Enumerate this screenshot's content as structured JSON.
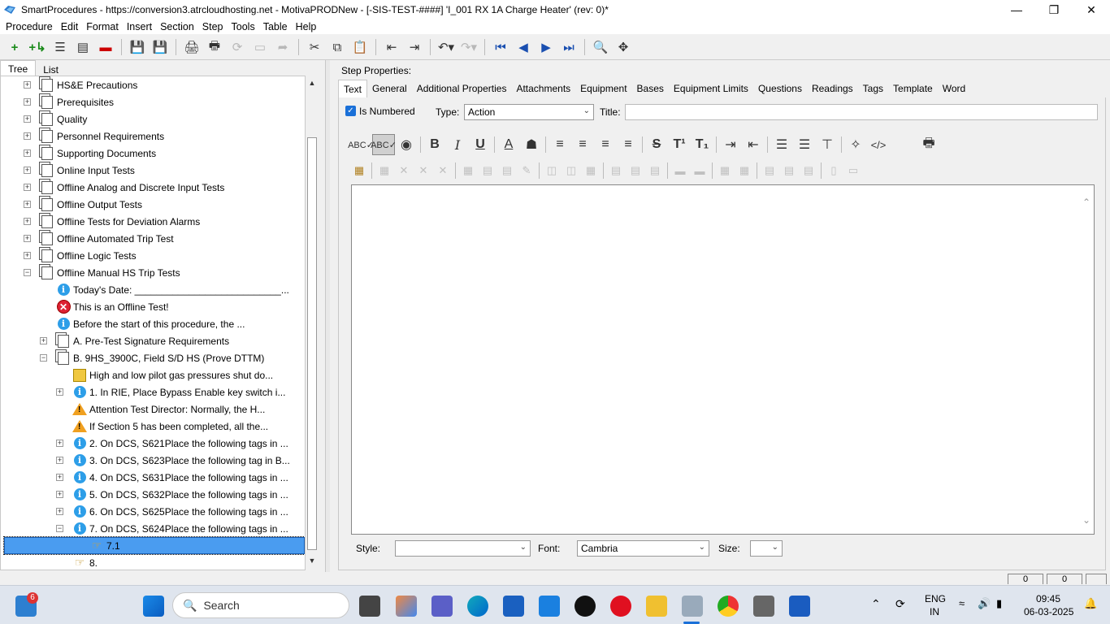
{
  "window": {
    "title": "SmartProcedures - https://conversion3.atrcloudhosting.net - MotivaPRODNew - [-SIS-TEST-####] 'I_001 RX 1A Charge Heater' (rev: 0)*"
  },
  "menu": [
    "Procedure",
    "Edit",
    "Format",
    "Insert",
    "Section",
    "Step",
    "Tools",
    "Table",
    "Help"
  ],
  "left_tabs": {
    "tree": "Tree",
    "list": "List"
  },
  "tree": [
    {
      "label": "HS&E Precautions",
      "icon": "document-icon",
      "expander": "+",
      "level": 0
    },
    {
      "label": "Prerequisites",
      "icon": "document-icon",
      "expander": "+",
      "level": 0
    },
    {
      "label": "Quality",
      "icon": "document-icon",
      "expander": "+",
      "level": 0
    },
    {
      "label": "Personnel Requirements",
      "icon": "document-icon",
      "expander": "+",
      "level": 0
    },
    {
      "label": "Supporting Documents",
      "icon": "document-icon",
      "expander": "+",
      "level": 0
    },
    {
      "label": "Online Input Tests",
      "icon": "document-icon",
      "expander": "+",
      "level": 0
    },
    {
      "label": "Offline Analog and Discrete Input Tests",
      "icon": "document-icon",
      "expander": "+",
      "level": 0
    },
    {
      "label": "Offline Output Tests",
      "icon": "document-icon",
      "expander": "+",
      "level": 0
    },
    {
      "label": "Offline Tests for Deviation Alarms",
      "icon": "document-icon",
      "expander": "+",
      "level": 0
    },
    {
      "label": "Offline Automated Trip Test",
      "icon": "document-icon",
      "expander": "+",
      "level": 0
    },
    {
      "label": "Offline Logic Tests",
      "icon": "document-icon",
      "expander": "+",
      "level": 0
    },
    {
      "label": "Offline Manual HS Trip Tests",
      "icon": "document-icon",
      "expander": "−",
      "level": 0
    },
    {
      "label": "Today's Date: ___________________________...",
      "icon": "info-icon",
      "expander": "",
      "level": 1
    },
    {
      "label": "This is an Offline Test!",
      "icon": "error-icon",
      "expander": "",
      "level": 1
    },
    {
      "label": "Before the start of this procedure, the ...",
      "icon": "info-icon",
      "expander": "",
      "level": 1
    },
    {
      "label": "A. Pre-Test Signature Requirements",
      "icon": "document-icon",
      "expander": "+",
      "level": 1
    },
    {
      "label": "B. 9HS_3900C, Field S/D HS (Prove DTTM)",
      "icon": "document-icon",
      "expander": "−",
      "level": 1
    },
    {
      "label": "High and low pilot gas pressures shut do...",
      "icon": "caution-icon",
      "expander": "",
      "level": 2
    },
    {
      "label": "1. In RIE, Place Bypass Enable key switch i...",
      "icon": "info-icon",
      "expander": "+",
      "level": 2
    },
    {
      "label": "Attention Test Director: Normally, the H...",
      "icon": "warning-icon",
      "expander": "",
      "level": 2
    },
    {
      "label": "If Section 5 has been completed, all the...",
      "icon": "warning-icon",
      "expander": "",
      "level": 2
    },
    {
      "label": "2. On DCS, S621Place the following tags in ...",
      "icon": "info-icon",
      "expander": "+",
      "level": 2
    },
    {
      "label": "3. On DCS, S623Place the following tag in B...",
      "icon": "info-icon",
      "expander": "+",
      "level": 2
    },
    {
      "label": "4. On DCS, S631Place the following tags in ...",
      "icon": "info-icon",
      "expander": "+",
      "level": 2
    },
    {
      "label": "5. On DCS, S632Place the following tags in ...",
      "icon": "info-icon",
      "expander": "+",
      "level": 2
    },
    {
      "label": "6. On DCS, S625Place the following tags in ...",
      "icon": "info-icon",
      "expander": "+",
      "level": 2
    },
    {
      "label": "7. On DCS, S624Place the following tags in ...",
      "icon": "info-icon",
      "expander": "−",
      "level": 2
    },
    {
      "label": "7.1",
      "icon": "hand-icon",
      "expander": "",
      "level": 3,
      "selected": true
    },
    {
      "label": "8.",
      "icon": "hand-icon",
      "expander": "",
      "level": 2
    }
  ],
  "step_properties": {
    "label": "Step Properties:",
    "tabs": [
      "Text",
      "General",
      "Additional Properties",
      "Attachments",
      "Equipment",
      "Bases",
      "Equipment Limits",
      "Questions",
      "Readings",
      "Tags",
      "Template",
      "Word"
    ],
    "is_numbered_label": "Is Numbered",
    "is_numbered": true,
    "type_label": "Type:",
    "type_value": "Action",
    "title_label": "Title:",
    "title_value": "",
    "style_label": "Style:",
    "style_value": "",
    "font_label": "Font:",
    "font_value": "Cambria",
    "size_label": "Size:",
    "size_value": ""
  },
  "status": {
    "box1": "0",
    "box2": "0"
  },
  "taskbar": {
    "search_label": "Search",
    "notification_badge": "6",
    "lang_line1": "ENG",
    "lang_line2": "IN",
    "time": "09:45",
    "date": "06-03-2025"
  },
  "colors": {
    "selection": "#4a9cf0",
    "accent": "#1a70d8",
    "info": "#2d9ee8",
    "warning": "#f0a020",
    "error": "#d22233"
  }
}
